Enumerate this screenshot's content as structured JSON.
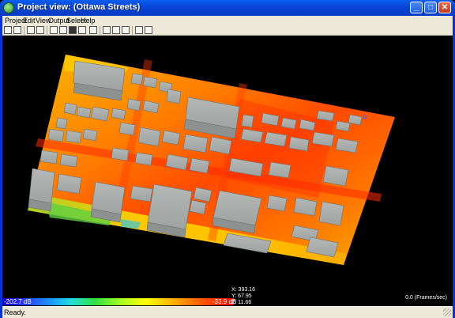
{
  "window": {
    "title": "Project view: (Ottawa Streets)",
    "minimize_glyph": "_",
    "maximize_glyph": "□",
    "close_glyph": "✕"
  },
  "menu": {
    "items": [
      "Project",
      "Edit",
      "View",
      "Output",
      "Select",
      "Help"
    ]
  },
  "toolbar": {
    "icons": [
      "open-project-icon",
      "open-icon",
      "save-icon",
      "view-icon",
      "wireframe-icon",
      "box-icon",
      "box-open-icon",
      "camera-icon",
      "render-icon",
      "solid-icon",
      "arrow-right-icon",
      "arrow-both-icon",
      "chart-icon",
      "grid-icon",
      "settings-icon"
    ]
  },
  "legend": {
    "min_label": "-202.7 dB",
    "max_label": "-33.9 dB",
    "colors": [
      "#1a00c8",
      "#2a3cff",
      "#1aa0ff",
      "#22e0d8",
      "#30e040",
      "#b0ff20",
      "#ffff00",
      "#ffb000",
      "#ff5a00",
      "#ff0000"
    ]
  },
  "readout": {
    "x": "X: 393.16",
    "y": "Y: 67.95",
    "z": "Z: 11.66"
  },
  "fps": "0.0 (Frames/sec)",
  "status": "Ready."
}
